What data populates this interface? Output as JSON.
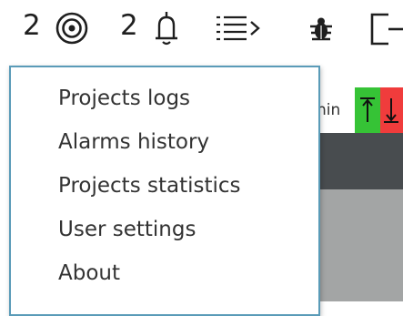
{
  "toolbar": {
    "targets_count": "2",
    "alarms_count": "2",
    "icons": [
      "target-icon",
      "bell-icon",
      "list-menu-icon",
      "bug-icon",
      "logout-icon"
    ]
  },
  "background": {
    "partial_label": "nin",
    "up_arrow": "↑",
    "down_arrow": "↓",
    "colors": {
      "up_button": "#36c336",
      "down_button": "#f03c3c",
      "dark_bar": "#484c4f",
      "grey_area": "#a3a5a5"
    }
  },
  "menu": {
    "border_color": "#5a9bb8",
    "items": [
      {
        "label": "Projects logs"
      },
      {
        "label": "Alarms history"
      },
      {
        "label": "Projects statistics"
      },
      {
        "label": "User settings"
      },
      {
        "label": "About"
      }
    ]
  }
}
